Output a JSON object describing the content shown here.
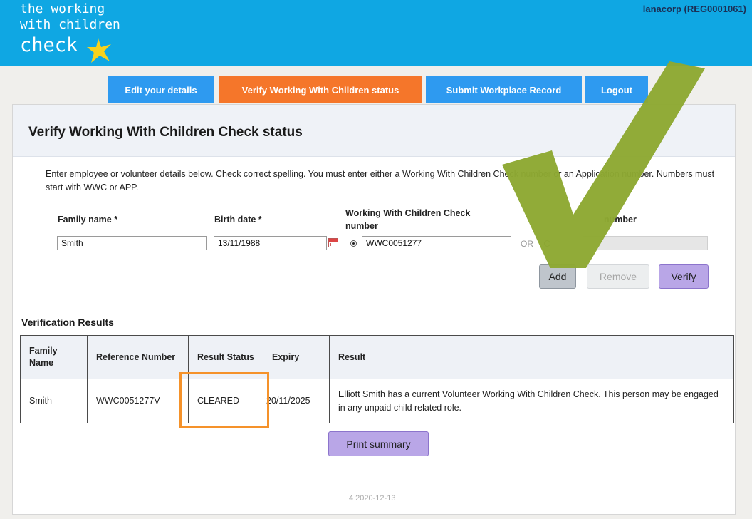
{
  "header": {
    "logo_line1": "the working",
    "logo_line2": "with children",
    "logo_line3": "check",
    "account": "lanacorp (REG0001061)"
  },
  "nav": {
    "tabs": [
      {
        "label": "Edit your details"
      },
      {
        "label": "Verify Working With Children status",
        "active": true
      },
      {
        "label": "Submit Workplace Record"
      },
      {
        "label": "Logout"
      }
    ]
  },
  "page": {
    "title": "Verify Working With Children Check status",
    "intro": "Enter employee or volunteer details below. Check correct spelling. You must enter either a Working With Children Check number or an Application number. Numbers must start with WWC or APP."
  },
  "form": {
    "family_name_label": "Family name *",
    "family_name_value": "Smith",
    "birth_date_label": "Birth date *",
    "birth_date_value": "13/11/1988",
    "wwc_label_line1": "Working With Children Check",
    "wwc_label_line2": "number",
    "wwc_value": "WWC0051277",
    "or_label": "OR",
    "app_label": "number",
    "add_label": "Add",
    "remove_label": "Remove",
    "verify_label": "Verify"
  },
  "results": {
    "title": "Verification Results",
    "columns": [
      "Family Name",
      "Reference Number",
      "Result Status",
      "Expiry",
      "Result"
    ],
    "rows": [
      {
        "family_name": "Smith",
        "reference": "WWC0051277V",
        "status": "CLEARED",
        "expiry": "20/11/2025",
        "result": "Elliott Smith has a current Volunteer Working With Children Check. This person may be engaged in any unpaid child related role."
      }
    ],
    "print_label": "Print summary"
  },
  "footer": {
    "version": "4 2020-12-13"
  },
  "colors": {
    "header_bg": "#0fa7e3",
    "tab_bg": "#2e9af0",
    "tab_active_bg": "#f5762a",
    "verify_btn": "#b9a6e7",
    "highlight": "#f5922a",
    "checkmark": "#8da832",
    "star": "#f7d21c"
  }
}
